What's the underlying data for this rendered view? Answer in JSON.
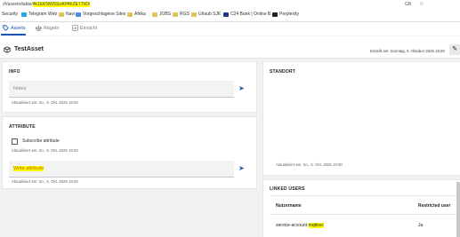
{
  "browser": {
    "url_prefix": "/#/assets/table/",
    "url_highlight": "4k1EKNWSSoAPAhZE77hDi",
    "zoom": "GB",
    "bookmarks": [
      "Security",
      "Telegram Web",
      "Navi",
      "Vorgeschlagene Sites",
      "Afrika",
      "JOBS",
      "RGS",
      "Urlaub SJK",
      "C24 Bank | Online B...",
      "Perplexity"
    ]
  },
  "tabs": [
    {
      "label": "Assets",
      "icon": "tag-icon"
    },
    {
      "label": "Regeln",
      "icon": "scale-icon"
    },
    {
      "label": "Einsicht",
      "icon": "chart-icon"
    }
  ],
  "header": {
    "title": "TestAsset",
    "created": "Erstellt am: Sonntag, 5. Oktober 2025 19:00"
  },
  "info": {
    "title": "INFO",
    "notes_label": "Notes",
    "updated": "Aktualisiert am: So., 5. Okt. 2025 19:00"
  },
  "attribute": {
    "title": "ATTRIBUTE",
    "subscribe_label": "Subscribe attribute",
    "subscribe_updated": "Aktualisiert am: So., 5. Okt. 2025 19:02",
    "write_label": "Write attribute",
    "write_updated": "Aktualisiert am: So., 5. Okt. 2025 19:02"
  },
  "standort": {
    "title": "STANDORT",
    "updated": "Aktualisiert am: So., 5. Okt. 2025 19:00"
  },
  "linked_users": {
    "title": "LINKED USERS",
    "headers": [
      "Nutzername",
      "Restricted user"
    ],
    "rows": [
      {
        "user_prefix": "service-account-",
        "user_highlight": "mqttsvc",
        "restricted": "Ja"
      }
    ]
  }
}
